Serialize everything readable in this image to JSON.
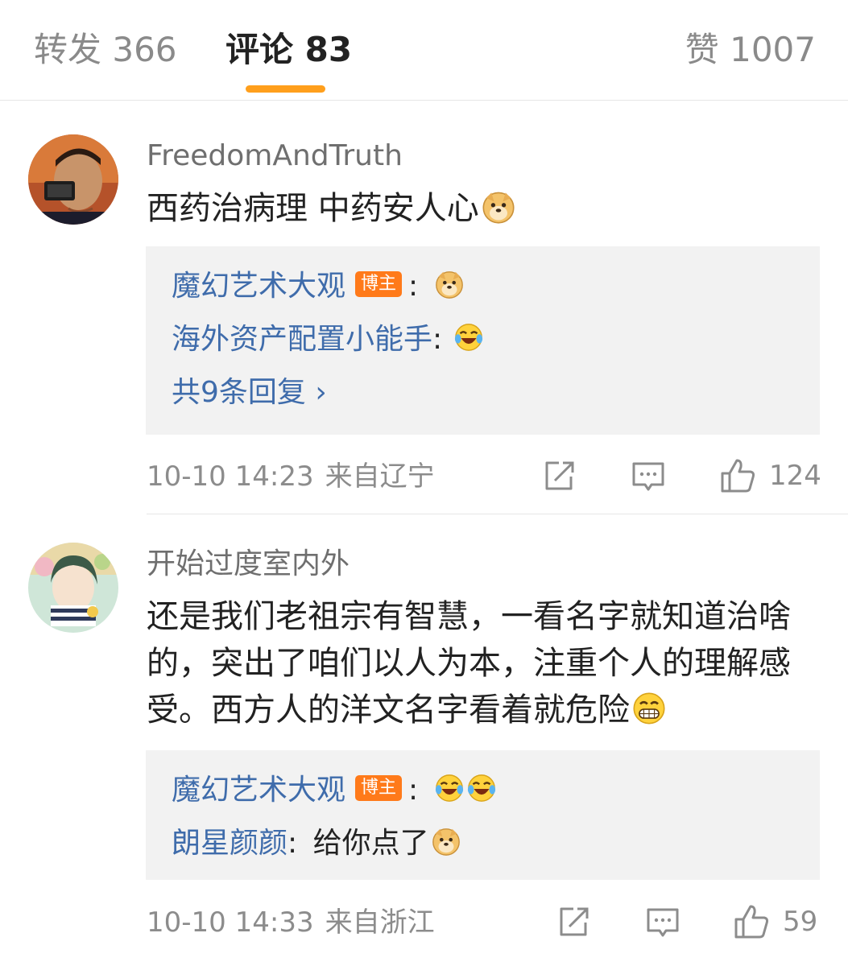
{
  "tabs": [
    {
      "label": "转发 366",
      "active": false
    },
    {
      "label": "评论 83",
      "active": true
    },
    {
      "label": "赞 1007",
      "active": false
    }
  ],
  "accent_color": "#ff9f1c",
  "name_link_color": "#3f6cab",
  "comments": [
    {
      "username": "FreedomAndTruth",
      "text": "西药治病理 中药安人心",
      "text_emoji": "doge-emoji",
      "replies": [
        {
          "name": "魔幻艺术大观",
          "badge": "博主",
          "sep": ":",
          "text": "",
          "emojis": [
            "doge-emoji"
          ]
        },
        {
          "name": "海外资产配置小能手",
          "badge": "",
          "sep": ":",
          "text": "",
          "emojis": [
            "laugh-cry-emoji"
          ]
        }
      ],
      "more_replies": "共9条回复 ›",
      "time": "10-10 14:23",
      "location": "来自辽宁",
      "likes": "124"
    },
    {
      "username": "开始过度室内外",
      "text": "还是我们老祖宗有智慧，一看名字就知道治啥的，突出了咱们以人为本，注重个人的理解感受。西方人的洋文名字看着就危险",
      "text_emoji": "grin-emoji",
      "replies": [
        {
          "name": "魔幻艺术大观",
          "badge": "博主",
          "sep": ":",
          "text": "",
          "emojis": [
            "laugh-cry-emoji",
            "laugh-cry-emoji"
          ]
        },
        {
          "name": "朗星颜颜",
          "badge": "",
          "sep": ":",
          "text": "给你点了",
          "emojis": [
            "doge-emoji"
          ]
        }
      ],
      "time": "10-10 14:33",
      "location": "来自浙江",
      "likes": "59"
    }
  ]
}
